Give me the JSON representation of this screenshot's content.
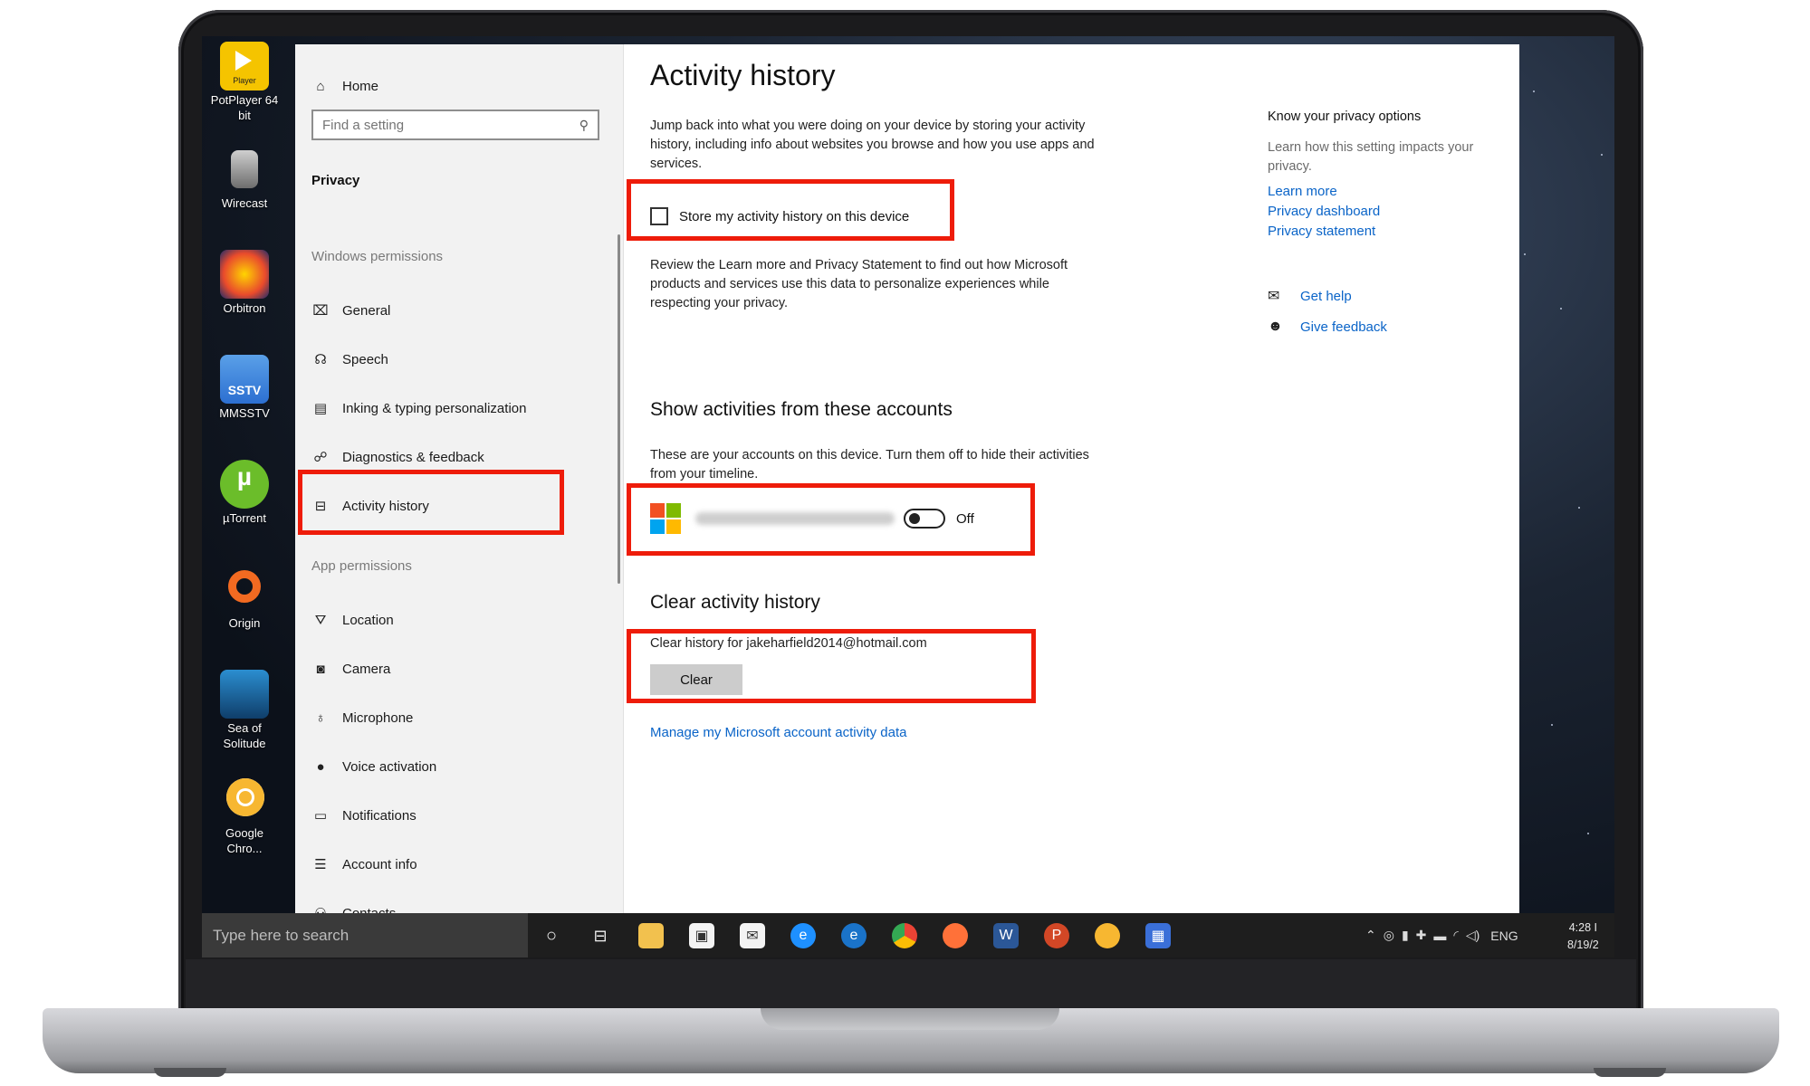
{
  "desktop": {
    "icons": [
      {
        "label": "PotPlayer 64 bit",
        "badge": "Player",
        "color": "#f5c400"
      },
      {
        "label": "Wirecast",
        "color": "#8a8a8a"
      },
      {
        "label": "Orbitron",
        "color": "#e94b2c"
      },
      {
        "label": "MMSSTV",
        "badge": "SSTV",
        "color": "#2c6fd1"
      },
      {
        "label": "µTorrent",
        "color": "#6bbd2a"
      },
      {
        "label": "Origin",
        "color": "#f26a21"
      },
      {
        "label": "Sea of Solitude",
        "color": "#1a6fa8"
      },
      {
        "label": "Google Chro...",
        "color": "#f7b731"
      }
    ]
  },
  "settings": {
    "home_label": "Home",
    "search_placeholder": "Find a setting",
    "section_title": "Privacy",
    "windows_permissions_heading": "Windows permissions",
    "windows_permissions": [
      {
        "label": "General",
        "icon": "lock-icon",
        "glyph": "🔒"
      },
      {
        "label": "Speech",
        "icon": "speech-icon",
        "glyph": "🗣"
      },
      {
        "label": "Inking & typing personalization",
        "icon": "clipboard-icon",
        "glyph": "📋"
      },
      {
        "label": "Diagnostics & feedback",
        "icon": "diagnostics-icon",
        "glyph": "⚲"
      },
      {
        "label": "Activity history",
        "icon": "timeline-icon",
        "glyph": "⧉"
      }
    ],
    "app_permissions_heading": "App permissions",
    "app_permissions": [
      {
        "label": "Location",
        "icon": "location-icon",
        "glyph": "⛛"
      },
      {
        "label": "Camera",
        "icon": "camera-icon",
        "glyph": "◙"
      },
      {
        "label": "Microphone",
        "icon": "microphone-icon",
        "glyph": "🎙"
      },
      {
        "label": "Voice activation",
        "icon": "voice-activation-icon",
        "glyph": "🎤"
      },
      {
        "label": "Notifications",
        "icon": "notifications-icon",
        "glyph": "▭"
      },
      {
        "label": "Account info",
        "icon": "account-info-icon",
        "glyph": "☰"
      },
      {
        "label": "Contacts",
        "icon": "contacts-icon",
        "glyph": "⚇"
      }
    ],
    "page_title": "Activity history",
    "intro": "Jump back into what you were doing on your device by storing your activity history, including info about websites you browse and how you use apps and services.",
    "store_checkbox_label": "Store my activity history on this device",
    "store_checkbox_checked": false,
    "review_text": "Review the Learn more and Privacy Statement to find out how Microsoft products and services use this data to personalize experiences while respecting your privacy.",
    "accounts_heading": "Show activities from these accounts",
    "accounts_text": "These are your accounts on this device. Turn them off to hide their activities from your timeline.",
    "account_toggle_label": "Off",
    "account_toggle_on": false,
    "clear_heading": "Clear activity history",
    "clear_text": "Clear history for jakeharfield2014@hotmail.com",
    "clear_button": "Clear",
    "manage_link": "Manage my Microsoft account activity data",
    "right": {
      "privacy_heading": "Know your privacy options",
      "privacy_text": "Learn how this setting impacts your privacy.",
      "links": [
        "Learn more",
        "Privacy dashboard",
        "Privacy statement"
      ],
      "get_help": "Get help",
      "give_feedback": "Give feedback"
    }
  },
  "taskbar": {
    "search_placeholder": "Type here to search",
    "language": "ENG",
    "time": "4:28 I",
    "date": "8/19/2"
  },
  "colors": {
    "highlight": "#ee1c0a",
    "link": "#0a64c8",
    "ms_red": "#f25022",
    "ms_green": "#7fba00",
    "ms_blue": "#00a4ef",
    "ms_yellow": "#ffb900"
  }
}
